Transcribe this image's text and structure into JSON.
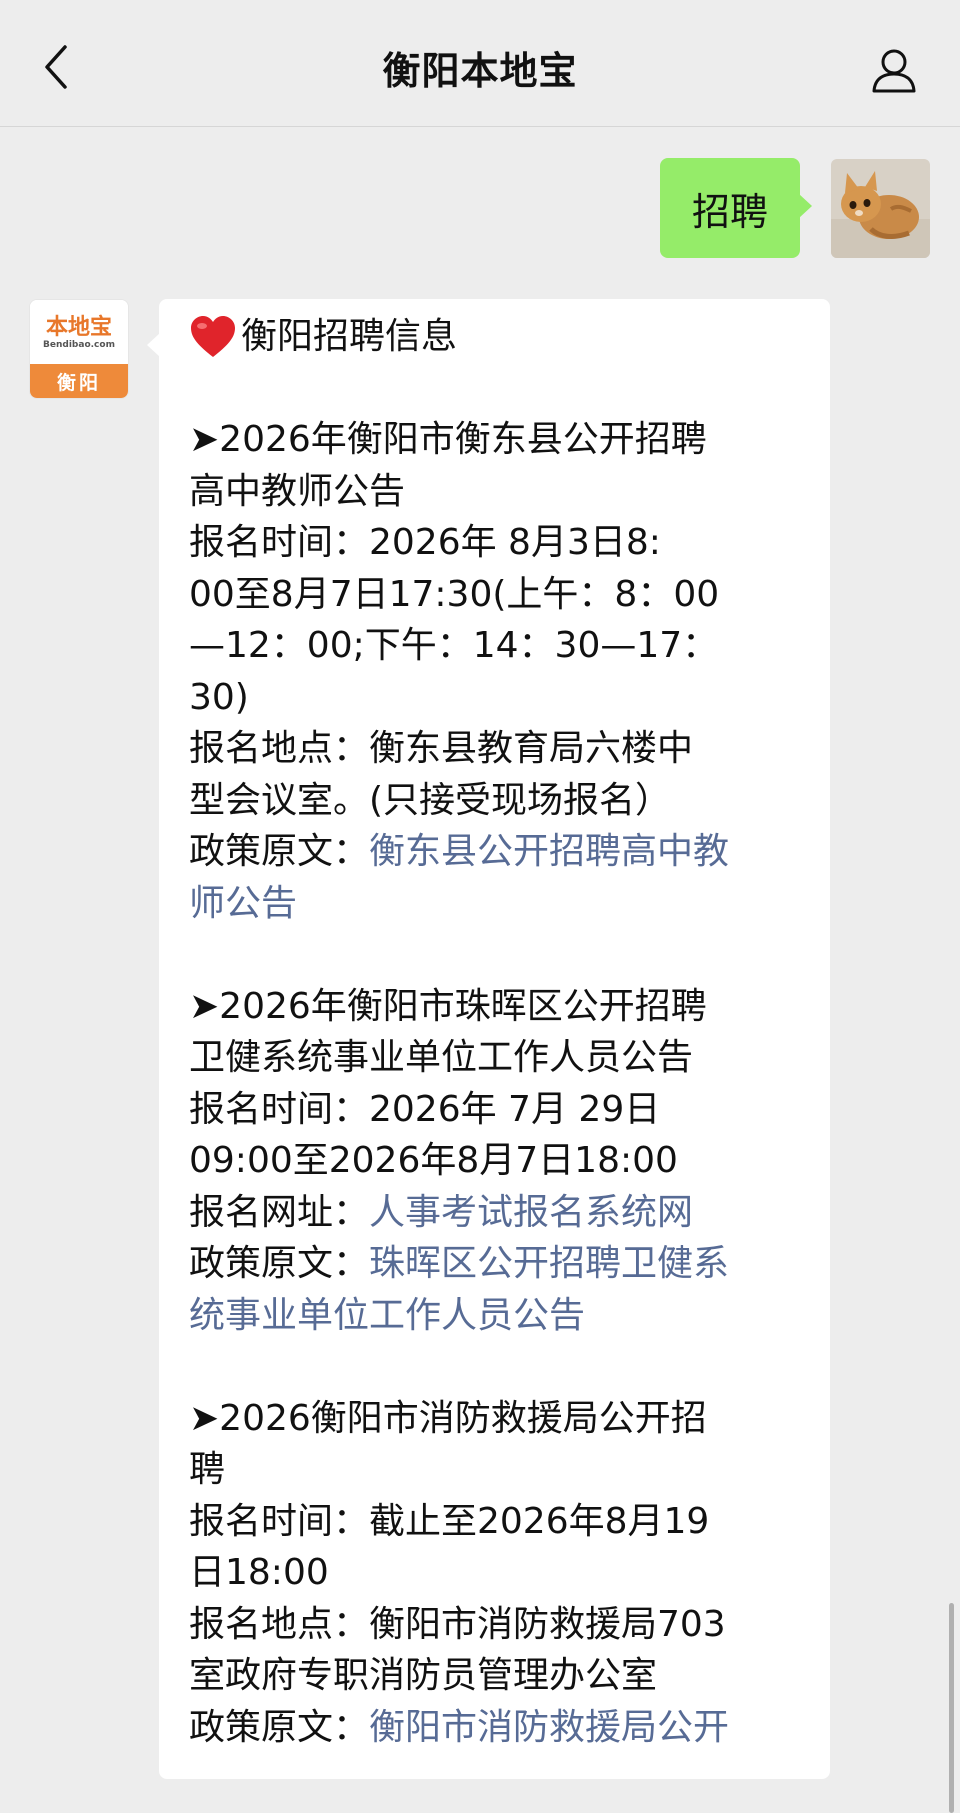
{
  "header": {
    "title": "衡阳本地宝",
    "back_icon": "chevron-left-icon",
    "profile_icon": "person-icon"
  },
  "outgoing": {
    "text": "招聘",
    "bubble_color": "#95ec69"
  },
  "bot": {
    "avatar": {
      "brand": "本地宝",
      "domain": "Bendibao.com",
      "city": "衡阳",
      "accent": "#ee8a3a"
    },
    "heading": "衡阳招聘信息",
    "heading_icon": "red-heart-icon",
    "link_color": "#576b95",
    "items": [
      {
        "title_lines": [
          "➤2026年衡阳市衡东县公开招聘",
          "高中教师公告"
        ],
        "time_lines": [
          "报名时间：2026年 8月3日8:",
          "00至8月7日17:30(上午：8：00",
          "—12：00;下午：14：30—17：",
          "30)"
        ],
        "place_lines": [
          "报名地点：衡东县教育局六楼中",
          "型会议室。(只接受现场报名）"
        ],
        "policy_label": "政策原文：",
        "policy_link_lines": [
          "衡东县公开招聘高中教",
          "师公告"
        ]
      },
      {
        "title_lines": [
          "➤2026年衡阳市珠晖区公开招聘",
          "卫健系统事业单位工作人员公告"
        ],
        "time_lines": [
          "报名时间：2026年 7月 29日",
          "09:00至2026年8月7日18:00"
        ],
        "site_label": "报名网址：",
        "site_link": "人事考试报名系统网",
        "policy_label": "政策原文：",
        "policy_link_lines": [
          "珠晖区公开招聘卫健系",
          "统事业单位工作人员公告"
        ]
      },
      {
        "title_lines": [
          "➤2026衡阳市消防救援局公开招",
          "聘"
        ],
        "time_lines": [
          "报名时间：截止至2026年8月19",
          "日18:00"
        ],
        "place_lines": [
          "报名地点：衡阳市消防救援局703",
          "室政府专职消防员管理办公室"
        ],
        "policy_label": "政策原文：",
        "policy_link_lines": [
          "衡阳市消防救援局公开"
        ]
      }
    ]
  }
}
